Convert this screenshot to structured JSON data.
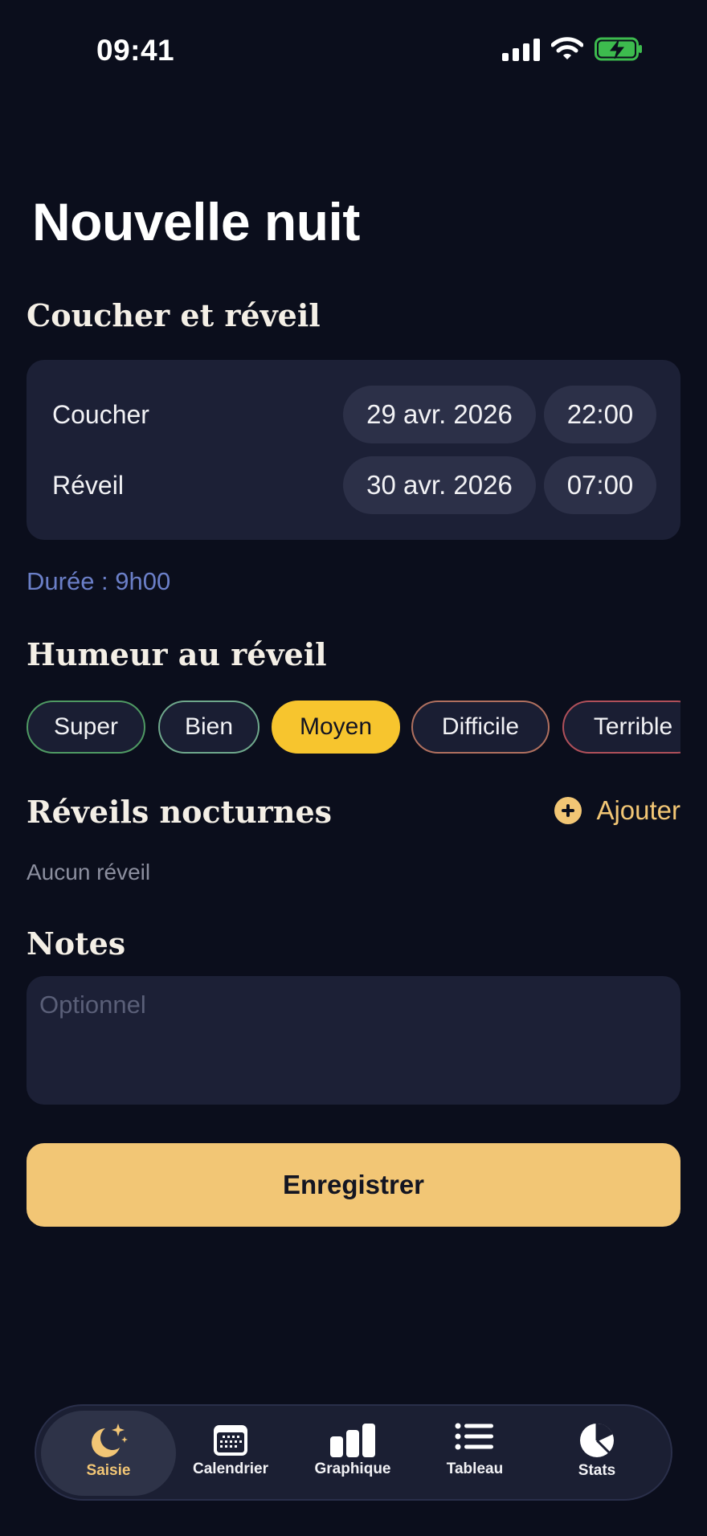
{
  "status_bar": {
    "time": "09:41"
  },
  "page_title": "Nouvelle nuit",
  "bedtime_section": {
    "title": "Coucher et réveil",
    "rows": [
      {
        "label": "Coucher",
        "date": "29 avr. 2026",
        "time": "22:00"
      },
      {
        "label": "Réveil",
        "date": "30 avr. 2026",
        "time": "07:00"
      }
    ],
    "duration": "Durée : 9h00"
  },
  "mood_section": {
    "title": "Humeur au réveil",
    "selected": "Moyen",
    "options": [
      {
        "label": "Super",
        "color": "#4f9a63"
      },
      {
        "label": "Bien",
        "color": "#6fa88c"
      },
      {
        "label": "Moyen",
        "color": "#f7c52e"
      },
      {
        "label": "Difficile",
        "color": "#b0705f"
      },
      {
        "label": "Terrible",
        "color": "#b0505a"
      }
    ]
  },
  "wakeups_section": {
    "title": "Réveils nocturnes",
    "add_label": "Ajouter",
    "empty_text": "Aucun réveil"
  },
  "notes_section": {
    "title": "Notes",
    "placeholder": "Optionnel",
    "value": ""
  },
  "save_label": "Enregistrer",
  "tab_bar": {
    "active": "Saisie",
    "tabs": [
      {
        "label": "Saisie",
        "icon": "moon-stars-icon"
      },
      {
        "label": "Calendrier",
        "icon": "calendar-icon"
      },
      {
        "label": "Graphique",
        "icon": "bar-chart-icon"
      },
      {
        "label": "Tableau",
        "icon": "list-icon"
      },
      {
        "label": "Stats",
        "icon": "pie-chart-icon"
      }
    ]
  },
  "colors": {
    "background": "#0b0e1c",
    "card": "#1c2036",
    "accent": "#f2c675",
    "selected_chip": "#f7c52e",
    "duration_text": "#6b7fc8"
  }
}
